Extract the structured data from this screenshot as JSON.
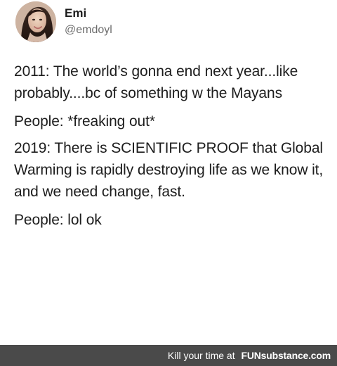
{
  "profile": {
    "name": "Emi",
    "handle": "@emdoyl"
  },
  "tweet": {
    "paragraphs": [
      "2011: The world’s gonna end next year...like probably....bc of something w the Mayans",
      "People: *freaking out*",
      "2019: There is SCIENTIFIC PROOF that Global Warming is rapidly destroying life as we know it, and we need change, fast.",
      "People: lol ok"
    ]
  },
  "footer": {
    "tagline": "Kill your time at",
    "brand_prefix": "FUN",
    "brand_suffix": "substance.com"
  },
  "colors": {
    "background": "#ffffff",
    "text": "#1d1d1d",
    "handle": "#6d6d6d",
    "footer_bg": "#4a4a4a",
    "footer_text": "#ffffff"
  }
}
